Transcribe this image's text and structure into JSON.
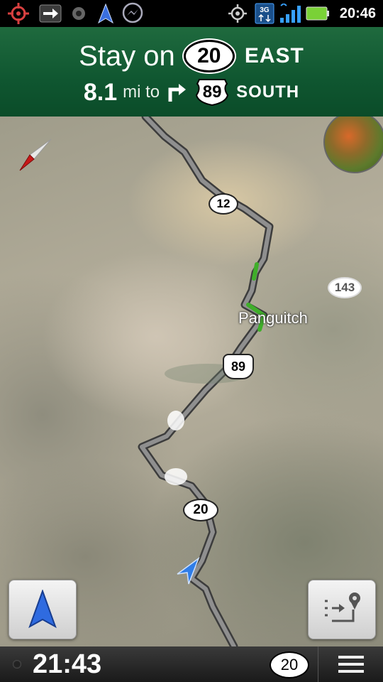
{
  "status_bar": {
    "time": "20:46",
    "network": "3G",
    "icons": [
      "crosshair-gps-icon",
      "usb-arrow-icon",
      "record-icon",
      "navigation-arrow-icon",
      "messenger-icon",
      "gps-target-icon",
      "data-transfer-icon",
      "signal-strength-icon",
      "battery-icon"
    ],
    "battery_color": "#7ad137"
  },
  "banner": {
    "line1_prefix": "Stay on",
    "current_road": "20",
    "current_direction": "EAST",
    "distance": "8.1",
    "distance_unit": "mi to",
    "next_road": "89",
    "next_direction": "SOUTH",
    "turn": "right-turn-icon",
    "background": "#0f5630"
  },
  "map": {
    "town": "Panguitch",
    "shields": [
      {
        "id": "route-12",
        "label": "12"
      },
      {
        "id": "route-143",
        "label": "143"
      },
      {
        "id": "route-89",
        "label": "89"
      },
      {
        "id": "route-20",
        "label": "20"
      }
    ],
    "route_color": "#8a8a8a",
    "traffic_color": "#3fae2a"
  },
  "bottom_bar": {
    "arrival_time": "21:43",
    "road": "20"
  }
}
